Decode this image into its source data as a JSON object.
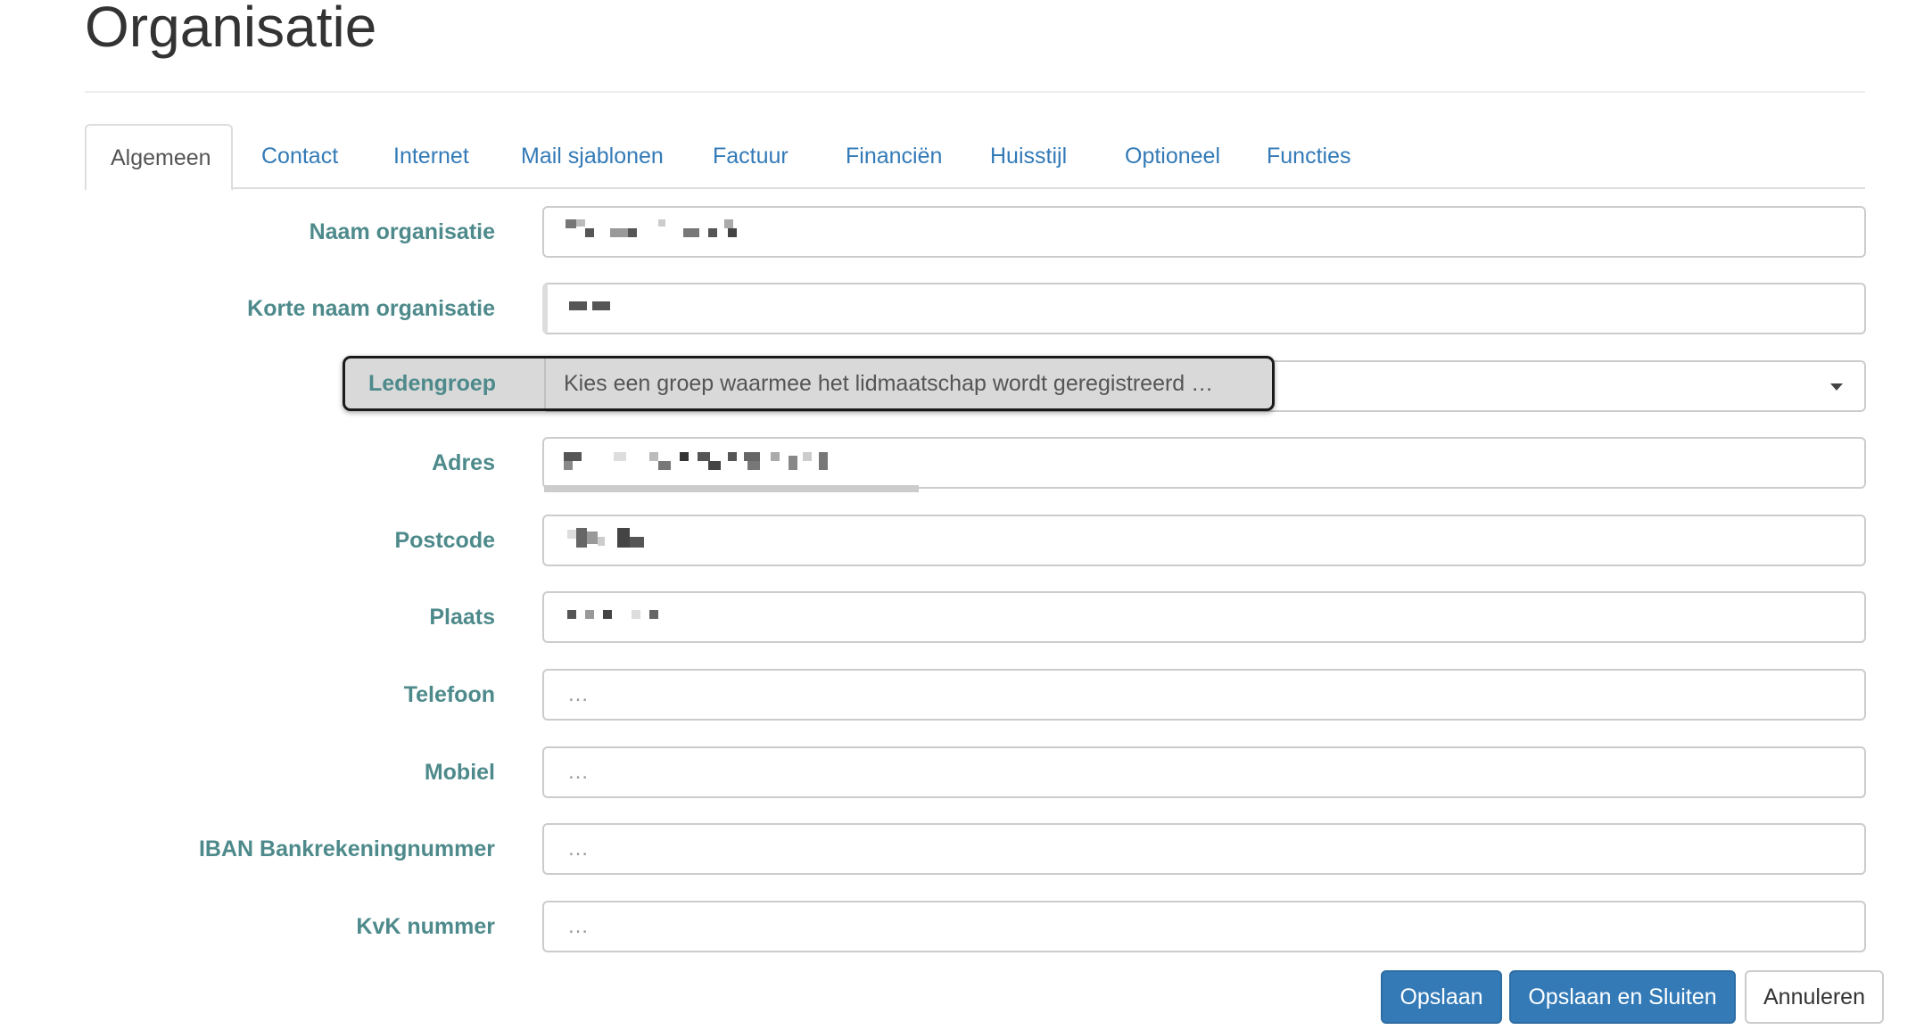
{
  "page": {
    "title": "Organisatie"
  },
  "tabs": [
    {
      "label": "Algemeen",
      "active": true
    },
    {
      "label": "Contact"
    },
    {
      "label": "Internet"
    },
    {
      "label": "Mail sjablonen"
    },
    {
      "label": "Factuur"
    },
    {
      "label": "Financiën"
    },
    {
      "label": "Huisstijl"
    },
    {
      "label": "Optioneel"
    },
    {
      "label": "Functies"
    }
  ],
  "form": {
    "naam": {
      "label": "Naam organisatie",
      "value": ""
    },
    "korte_naam": {
      "label": "Korte naam organisatie",
      "value": ""
    },
    "ledengroep": {
      "label": "Ledengroep",
      "placeholder": "Kies een groep waarmee het lidmaatschap wordt geregistreerd …"
    },
    "adres": {
      "label": "Adres",
      "value": ""
    },
    "postcode": {
      "label": "Postcode",
      "value": ""
    },
    "plaats": {
      "label": "Plaats",
      "value": ""
    },
    "telefoon": {
      "label": "Telefoon",
      "placeholder": "…"
    },
    "mobiel": {
      "label": "Mobiel",
      "placeholder": "…"
    },
    "iban": {
      "label": "IBAN Bankrekeningnummer",
      "placeholder": "…"
    },
    "kvk": {
      "label": "KvK nummer",
      "placeholder": "…"
    }
  },
  "buttons": {
    "save": "Opslaan",
    "save_close": "Opslaan en Sluiten",
    "cancel": "Annuleren"
  },
  "colors": {
    "label": "#4e8a8b",
    "link": "#337ab7",
    "primary": "#337ab7"
  },
  "icons": {
    "select_caret": "caret-down-icon"
  }
}
